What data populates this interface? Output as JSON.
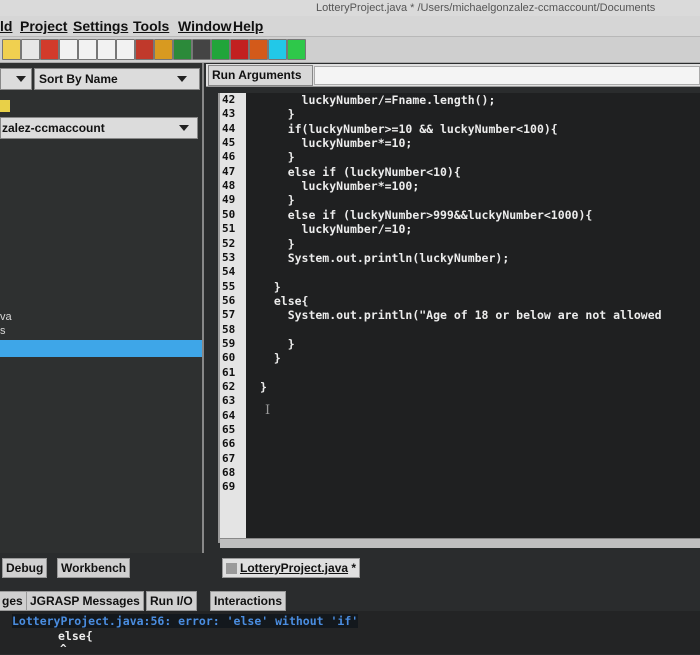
{
  "window": {
    "title": "LotteryProject.java *  /Users/michaelgonzalez-ccmaccount/Documents"
  },
  "menu": [
    "ld",
    "Project",
    "Settings",
    "Tools",
    "Window",
    "Help"
  ],
  "toolbar": {
    "icons": [
      "build-icon",
      "compile-icon",
      "undo-icon",
      "document-icon",
      "document-icon",
      "document-icon",
      "document-icon",
      "flag-icon",
      "chart-icon",
      "tree-icon",
      "check-icon",
      "add-icon",
      "bug-icon",
      "run-icon",
      "cyan-square-icon",
      "green-square-icon"
    ],
    "colors": [
      "#f0d050",
      "#e6e6e6",
      "#d23b2b",
      "#f2f2f2",
      "#f2f2f2",
      "#f2f2f2",
      "#f2f2f2",
      "#c0392b",
      "#d89a20",
      "#2c8a3a",
      "#444444",
      "#21a53a",
      "#c22020",
      "#d35a1a",
      "#22c8e8",
      "#2ec84a"
    ]
  },
  "browser": {
    "sort_label": "Sort By Name",
    "folder_label": "zalez-ccmaccount",
    "files": [
      "va",
      "s"
    ]
  },
  "run_args": {
    "label": "Run Arguments",
    "value": ""
  },
  "editor": {
    "line_numbers": [
      "42",
      "43",
      "44",
      "45",
      "46",
      "47",
      "48",
      "49",
      "50",
      "51",
      "52",
      "53",
      "54",
      "55",
      "56",
      "57",
      "58",
      "59",
      "60",
      "61",
      "62",
      "63",
      "64",
      "65",
      "66",
      "67",
      "68",
      "69"
    ],
    "code_lines": [
      "      luckyNumber/=Fname.length();",
      "    }",
      "    if(luckyNumber>=10 && luckyNumber<100){",
      "      luckyNumber*=10;",
      "    }",
      "    else if (luckyNumber<10){",
      "      luckyNumber*=100;",
      "    }",
      "    else if (luckyNumber>999&&luckyNumber<1000){",
      "      luckyNumber/=10;",
      "    }",
      "    System.out.println(luckyNumber);",
      "",
      "  }",
      "  else{",
      "    System.out.println(\"Age of 18 or below are not allowed",
      "",
      "    }",
      "  }",
      "",
      "}",
      "",
      "",
      "",
      "",
      "",
      "",
      ""
    ]
  },
  "left_tabs": [
    "Debug",
    "Workbench"
  ],
  "file_tab": {
    "label": "LotteryProject.java",
    "modified": "*"
  },
  "bottom_tabs": [
    "ges",
    "JGRASP Messages",
    "Run I/O",
    "Interactions"
  ],
  "messages": {
    "error_line": "LotteryProject.java:56: error: 'else' without 'if'",
    "code_line": "else{",
    "caret": "^"
  }
}
